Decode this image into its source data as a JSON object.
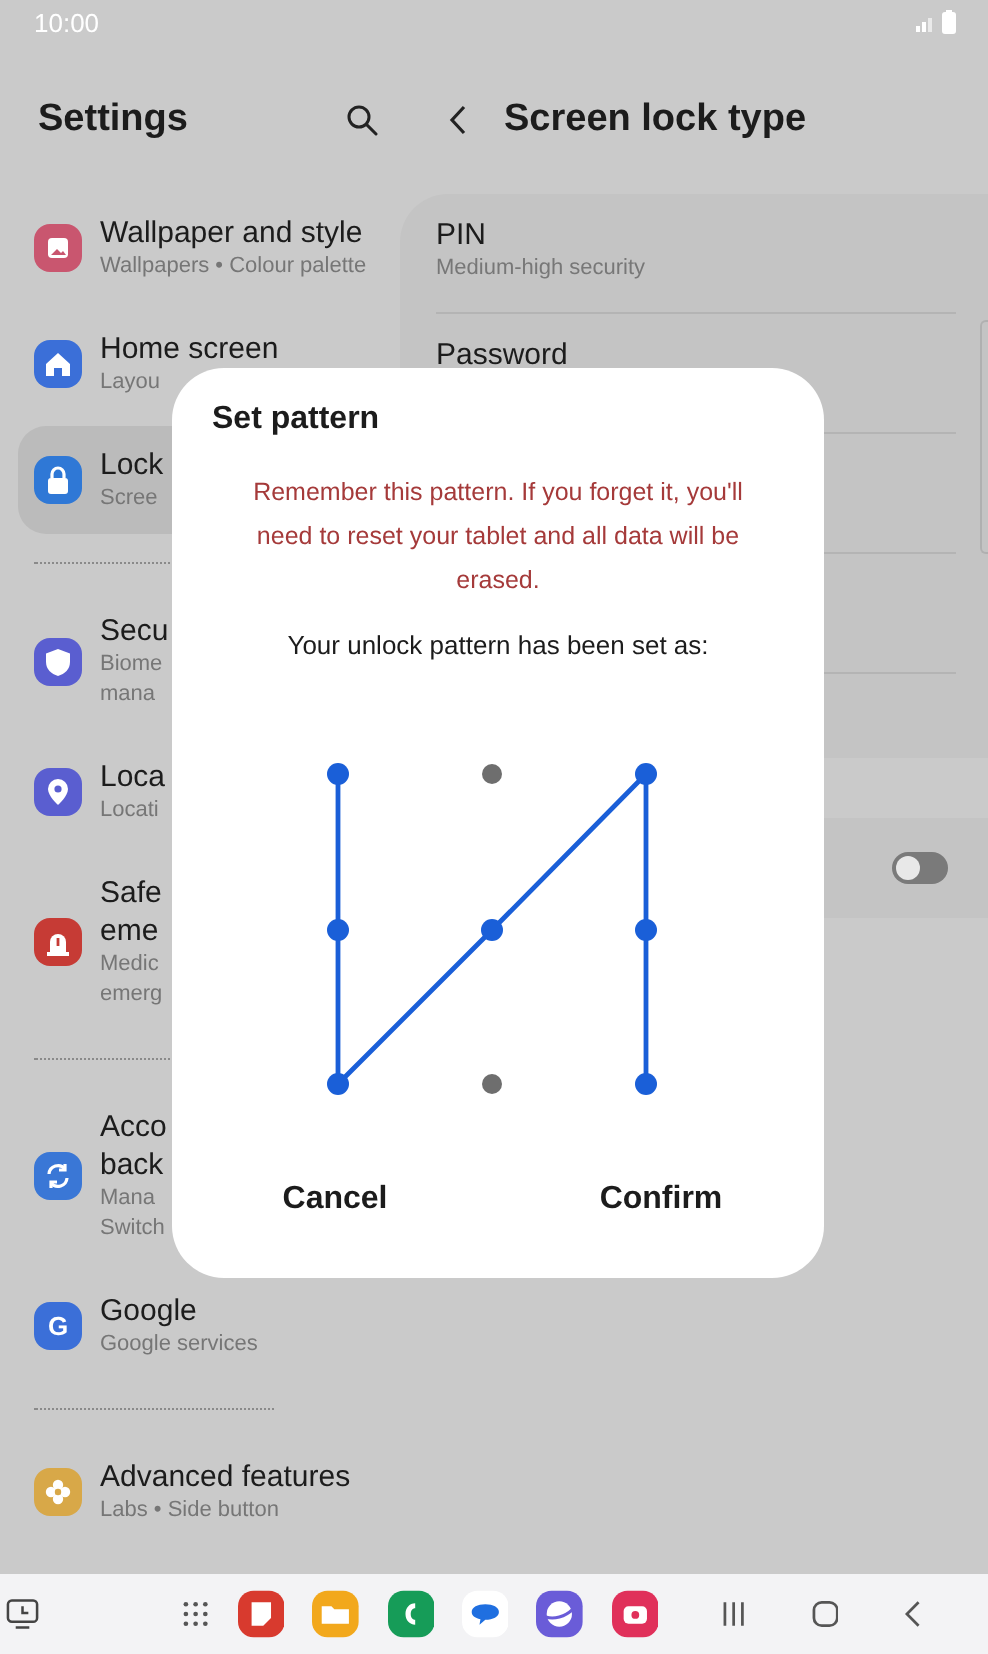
{
  "status_bar": {
    "time": "10:00"
  },
  "sidebar": {
    "title": "Settings",
    "groups": [
      {
        "items": [
          {
            "kind": "wallpaper",
            "color": "#c9566f",
            "title": [
              "Wallpaper and style"
            ],
            "subtitle": [
              "Wallpapers • Colour palette"
            ],
            "selected": false
          },
          {
            "kind": "home",
            "color": "#3b6fd8",
            "title": [
              "Home screen"
            ],
            "subtitle": [
              "Layou"
            ],
            "selected": false
          },
          {
            "kind": "lock",
            "color": "#2f78d6",
            "title": [
              "Lock"
            ],
            "subtitle": [
              "Scree"
            ],
            "selected": true
          }
        ]
      },
      {
        "items": [
          {
            "kind": "shield",
            "color": "#5a5ed0",
            "title": [
              "Secu"
            ],
            "subtitle": [
              "Biome",
              "mana"
            ],
            "selected": false
          },
          {
            "kind": "location",
            "color": "#5a5ed0",
            "title": [
              "Loca"
            ],
            "subtitle": [
              "Locati"
            ],
            "selected": false
          },
          {
            "kind": "alert",
            "color": "#c63b35",
            "title": [
              "Safe",
              "eme"
            ],
            "subtitle": [
              "Medic",
              "emerg"
            ],
            "selected": false
          }
        ]
      },
      {
        "items": [
          {
            "kind": "sync",
            "color": "#3a77d6",
            "title": [
              "Acco",
              "back"
            ],
            "subtitle": [
              "Mana",
              "Switch"
            ],
            "selected": false
          },
          {
            "kind": "google",
            "color": "#3b6fd8",
            "glyph": "G",
            "title": [
              "Google"
            ],
            "subtitle": [
              "Google services"
            ],
            "selected": false
          }
        ]
      },
      {
        "items": [
          {
            "kind": "gear",
            "color": "#d8a848",
            "title": [
              "Advanced features"
            ],
            "subtitle": [
              "Labs • Side button"
            ],
            "selected": false
          }
        ]
      }
    ]
  },
  "detail": {
    "title": "Screen lock type",
    "options": [
      {
        "title": "PIN",
        "subtitle": "Medium-high security"
      },
      {
        "title": "Password"
      }
    ],
    "toggle": {
      "on": false
    }
  },
  "dialog": {
    "title": "Set pattern",
    "warning": "Remember this pattern. If you forget it, you'll need to reset your tablet and all data will be erased.",
    "message": "Your unlock pattern has been set as:",
    "pattern": {
      "dots": [
        {
          "selected": true
        },
        {
          "selected": false
        },
        {
          "selected": true
        },
        {
          "selected": true
        },
        {
          "selected": true
        },
        {
          "selected": true
        },
        {
          "selected": true
        },
        {
          "selected": false
        },
        {
          "selected": true
        }
      ],
      "path": [
        {
          "kind": "topleft"
        },
        {
          "kind": "middleleft"
        },
        {
          "kind": "bottomleft"
        },
        {
          "kind": "center"
        },
        {
          "kind": "topright"
        },
        {
          "kind": "middleright"
        },
        {
          "kind": "bottomright"
        }
      ]
    },
    "buttons": [
      "Cancel",
      "Confirm"
    ]
  },
  "taskbar": {
    "apps": [
      {
        "kind": "notes",
        "color": "#d83a2e"
      },
      {
        "kind": "folder",
        "color": "#f2a81c"
      },
      {
        "kind": "phone",
        "color": "#169c58"
      },
      {
        "kind": "messages",
        "color": "#1f6fe0"
      },
      {
        "kind": "browser",
        "color": "#6a5cd8"
      },
      {
        "kind": "camera",
        "color": "#e0305a"
      }
    ]
  }
}
